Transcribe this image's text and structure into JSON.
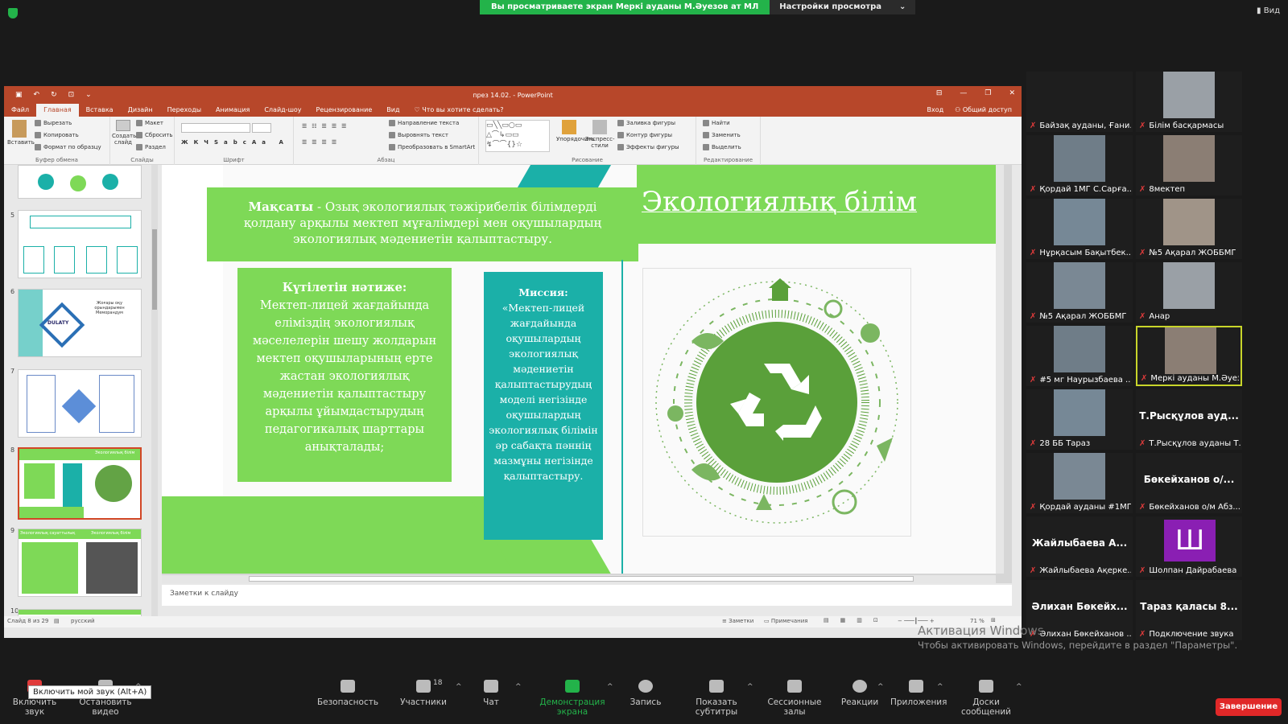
{
  "share": {
    "banner": "Вы просматриваете экран Меркі ауданы М.Әуезов ат МЛ",
    "settings": "Настройки просмотра",
    "view": "Вид"
  },
  "ppt": {
    "window_title": "през 14.02. - PowerPoint",
    "tabs": [
      "Файл",
      "Главная",
      "Вставка",
      "Дизайн",
      "Переходы",
      "Анимация",
      "Слайд-шоу",
      "Рецензирование",
      "Вид"
    ],
    "tell_me": "Что вы хотите сделать?",
    "sign_in": "Вход",
    "share": "Общий доступ",
    "ribbon": {
      "paste": "Вставить",
      "cut": "Вырезать",
      "copy": "Копировать",
      "format_painter": "Формат по образцу",
      "clipboard": "Буфер обмена",
      "new_slide": "Создать слайд",
      "layout": "Макет",
      "reset": "Сбросить",
      "section": "Раздел",
      "slides": "Слайды",
      "font": "Шрифт",
      "text_direction": "Направление текста",
      "align_text": "Выровнять текст",
      "smartart": "Преобразовать в SmartArt",
      "paragraph": "Абзац",
      "arrange": "Упорядочить",
      "quick_styles": "Экспресс-стили",
      "shape_fill": "Заливка фигуры",
      "shape_outline": "Контур фигуры",
      "shape_effects": "Эффекты фигуры",
      "drawing": "Рисование",
      "find": "Найти",
      "replace": "Заменить",
      "select": "Выделить",
      "editing": "Редактирование"
    },
    "thumbnails": [
      {
        "num": "5"
      },
      {
        "num": "6",
        "text": "Жоғары оқу орындарымен Меморандум",
        "logo": "DULATY"
      },
      {
        "num": "7"
      },
      {
        "num": "8",
        "text": "Экологиялық білім"
      },
      {
        "num": "9",
        "text": "Экологиялық сауаттылық",
        "text2": "Экологиялық білім"
      },
      {
        "num": "10"
      }
    ],
    "notes_placeholder": "Заметки к слайду",
    "status": {
      "slide_of": "Слайд 8 из 29",
      "language": "русский",
      "notes": "Заметки",
      "comments": "Примечания",
      "zoom": "71 %"
    }
  },
  "slide": {
    "title": "Экологиялық білім",
    "goal_label": "Мақсаты",
    "goal_text": " - Озық экологиялық тәжірибелік білімдерді қолдану арқылы мектеп мұғалімдері мен оқушылардың экологиялық мәдениетін қалыптастыру.",
    "result_label": "Күтілетін нәтиже:",
    "result_text": "Мектеп-лицей жағдайында еліміздің экологиялық мәселелерін шешу жолдарын мектеп оқушыларының ерте жастан экологиялық мәдениетін қалыптастыру арқылы ұйымдастырудың педагогикалық шарттары анықталады;",
    "mission_label": "Миссия:",
    "mission_text": "«Мектеп-лицей жағдайында оқушылардың экологиялық мәдениетін қалыптастырудың моделі негізінде оқушылардың экологиялық білімін әр сабақта пәннің мазмұны негізінде қалыптастыру."
  },
  "participants": [
    {
      "name": "Байзақ ауданы, Ғани...",
      "video": false
    },
    {
      "name": "Білім басқармасы",
      "video": true
    },
    {
      "name": "Қордай 1МГ С.Сарға...",
      "video": true
    },
    {
      "name": "8мектеп",
      "video": true
    },
    {
      "name": "Нұрқасым Бақытбек...",
      "video": true
    },
    {
      "name": "№5 Ақарал ЖОББМГ",
      "video": true
    },
    {
      "name": "№5 Ақарал ЖОББМГ",
      "video": true
    },
    {
      "name": "Анар",
      "video": true
    },
    {
      "name": "#5 мг Наурызбаева ...",
      "video": true
    },
    {
      "name": "Меркі ауданы М.Әуезо...",
      "video": true,
      "speaking": true
    },
    {
      "name": "28 ББ Тараз",
      "video": true
    },
    {
      "name": "Т.Рысқұлов ауданы Т...",
      "video": false,
      "big": "Т.Рысқұлов ауд..."
    },
    {
      "name": "Қордай ауданы #1МГ",
      "video": true
    },
    {
      "name": "Бөкейханов о/м Абз...",
      "video": false,
      "big": "Бөкейханов о/..."
    },
    {
      "name": "Жайлыбаева Ақерке...",
      "video": false,
      "big": "Жайлыбаева А..."
    },
    {
      "name": "Шолпан Дайрабаева",
      "video": false,
      "avatar": "Ш"
    },
    {
      "name": "Әлихан Бөкейханов ...",
      "video": false,
      "big": "Әлихан Бөкейх..."
    },
    {
      "name": "Подключение звука",
      "video": false,
      "big": "Тараз қаласы 8..."
    }
  ],
  "watermark": {
    "line1": "Активация Windows",
    "line2": "Чтобы активировать Windows, перейдите в раздел \"Параметры\"."
  },
  "toolbar": {
    "tooltip": "Включить мой звук (Alt+A)",
    "unmute": "Включить звук",
    "video": "Остановить видео",
    "security": "Безопасность",
    "participants": "Участники",
    "participants_count": "18",
    "chat": "Чат",
    "share_screen": "Демонстрация экрана",
    "record": "Запись",
    "captions": "Показать субтитры",
    "breakout": "Сессионные залы",
    "reactions": "Реакции",
    "apps": "Приложения",
    "whiteboards": "Доски сообщений",
    "end": "Завершение"
  },
  "colors": {
    "ppt_accent": "#b7472a",
    "slide_green": "#7ed957",
    "slide_teal": "#1bb0a8",
    "zoom_green": "#23b34a",
    "end_red": "#e02828"
  }
}
